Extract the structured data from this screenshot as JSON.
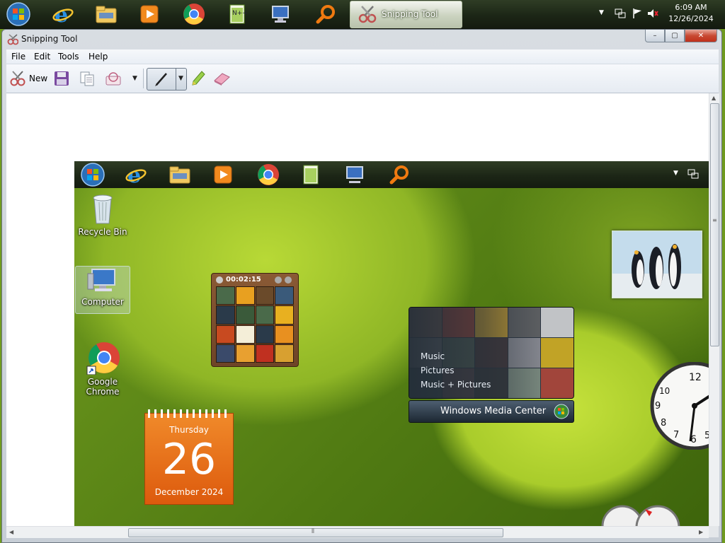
{
  "taskbar": {
    "pinned": [
      {
        "name": "windows-start-orb",
        "glyph": ""
      },
      {
        "name": "internet-explorer-icon"
      },
      {
        "name": "windows-explorer-icon"
      },
      {
        "name": "windows-media-player-icon"
      },
      {
        "name": "google-chrome-icon"
      },
      {
        "name": "notepad-plus-plus-icon"
      },
      {
        "name": "remote-desktop-icon"
      },
      {
        "name": "search-icon"
      }
    ],
    "active_task_label": "Snipping Tool",
    "clock": {
      "time": "6:09 AM",
      "date": "12/26/2024"
    }
  },
  "window": {
    "title": "Snipping Tool",
    "caption_buttons": {
      "minimize": "–",
      "maximize": "▢",
      "close": "✕"
    }
  },
  "menubar": {
    "items": [
      "File",
      "Edit",
      "Tools",
      "Help"
    ]
  },
  "toolbar": {
    "new_label": "New"
  },
  "captured_image": {
    "desktop_icons": [
      {
        "label": "Recycle Bin"
      },
      {
        "label": "Computer"
      },
      {
        "label": "Google Chrome",
        "line1": "Google",
        "line2": "Chrome"
      }
    ],
    "puzzle_timer": "00:02:15",
    "calendar": {
      "weekday": "Thursday",
      "day": "26",
      "month_year": "December 2024"
    },
    "media_center": {
      "items": [
        "Music",
        "Pictures",
        "Music + Pictures"
      ],
      "brand": "Windows Media Center"
    }
  },
  "colors": {
    "accent": "#dd5a0d",
    "taskbar": "#1c2616",
    "desktop": "#6f9a1e"
  }
}
